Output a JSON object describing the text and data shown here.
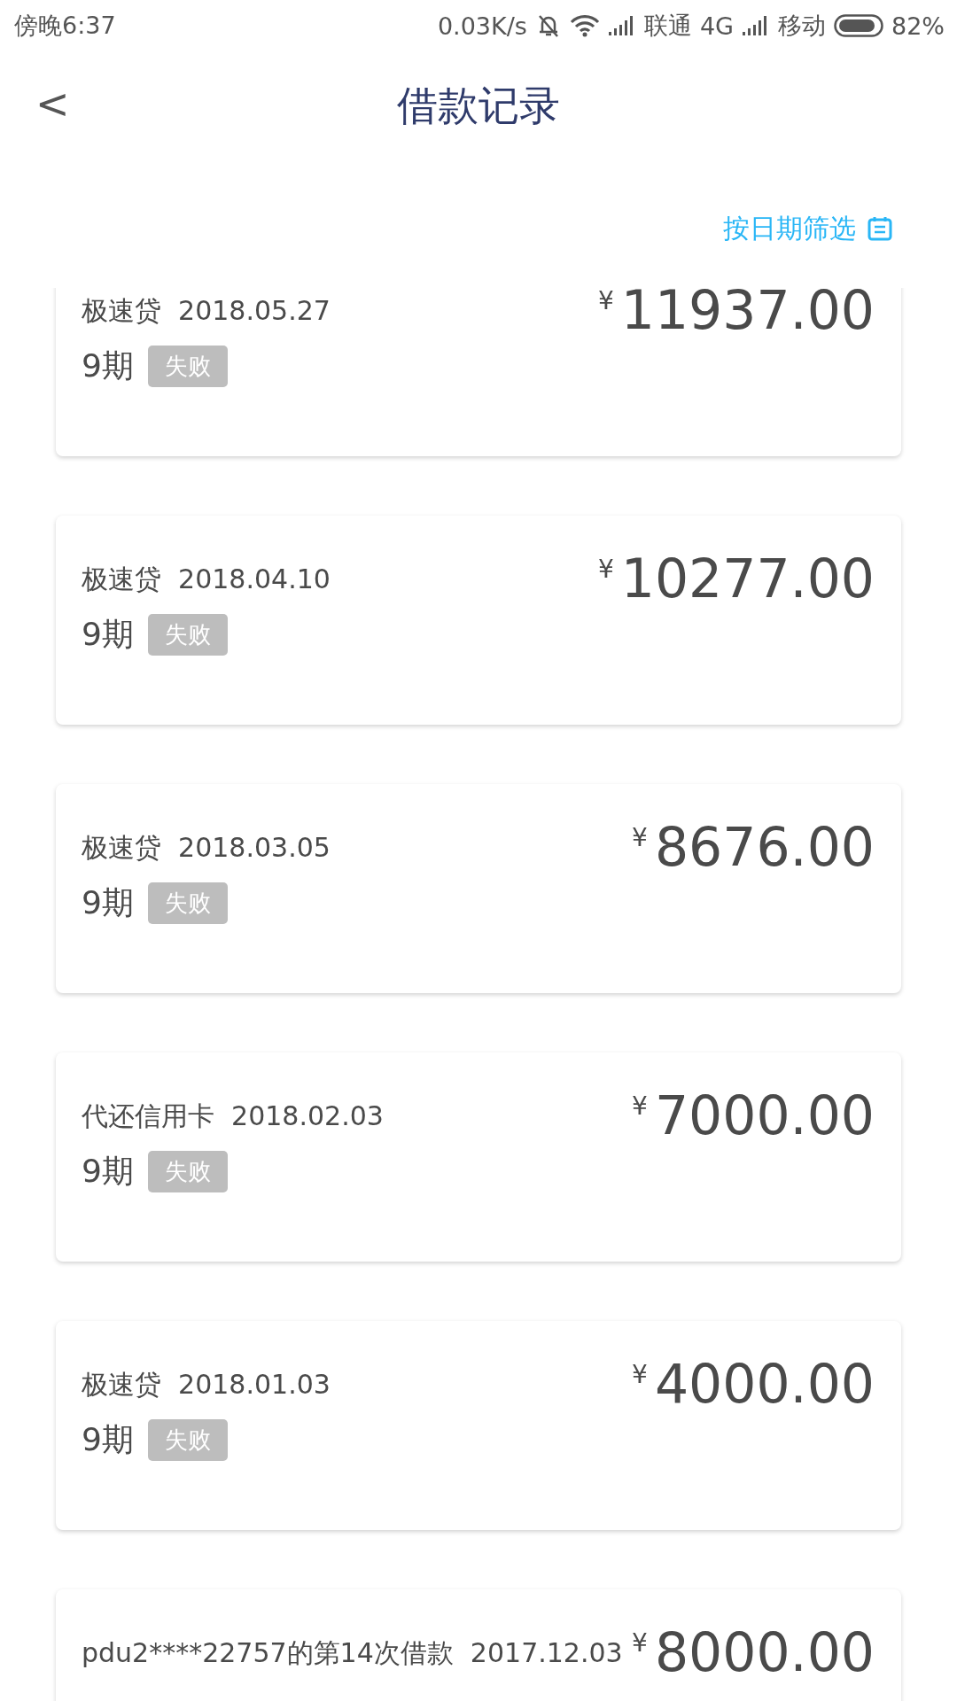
{
  "status_bar": {
    "time": "傍晚6:37",
    "speed": "0.03K/s",
    "carrier_1": "联通",
    "network_1": "4G",
    "carrier_2": "移动",
    "battery": "82%"
  },
  "header": {
    "back": "<",
    "title": "借款记录"
  },
  "filter": {
    "label": "按日期筛选"
  },
  "records": [
    {
      "name": "极速贷",
      "date": "2018.05.27",
      "currency": "¥",
      "amount": "11937.00",
      "term": "9期",
      "status": "失败"
    },
    {
      "name": "极速贷",
      "date": "2018.04.10",
      "currency": "¥",
      "amount": "10277.00",
      "term": "9期",
      "status": "失败"
    },
    {
      "name": "极速贷",
      "date": "2018.03.05",
      "currency": "¥",
      "amount": "8676.00",
      "term": "9期",
      "status": "失败"
    },
    {
      "name": "代还信用卡",
      "date": "2018.02.03",
      "currency": "¥",
      "amount": "7000.00",
      "term": "9期",
      "status": "失败"
    },
    {
      "name": "极速贷",
      "date": "2018.01.03",
      "currency": "¥",
      "amount": "4000.00",
      "term": "9期",
      "status": "失败"
    },
    {
      "name": "pdu2****22757的第14次借款",
      "date": "2017.12.03",
      "currency": "¥",
      "amount": "8000.00"
    }
  ]
}
